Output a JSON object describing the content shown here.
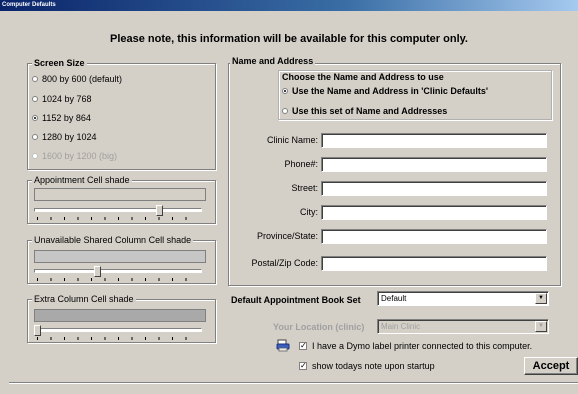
{
  "window": {
    "title": "Computer Defaults"
  },
  "notice": "Please note, this information will be available for this computer only.",
  "screen_size": {
    "title": "Screen Size",
    "options": [
      {
        "label": "800 by 600 (default)",
        "checked": false,
        "disabled": false
      },
      {
        "label": "1024 by 768",
        "checked": false,
        "disabled": false
      },
      {
        "label": "1152 by 864",
        "checked": true,
        "disabled": false
      },
      {
        "label": "1280 by 1024",
        "checked": false,
        "disabled": false
      },
      {
        "label": "1600 by 1200 (big)",
        "checked": false,
        "disabled": true
      }
    ]
  },
  "shades": {
    "appointment": {
      "title": "Appointment Cell shade",
      "color": "#d4d0c8",
      "level": 0.78
    },
    "unavailable": {
      "title": "Unavailable Shared Column Cell shade",
      "color": "#c6c6c6",
      "level": 0.36
    },
    "extra": {
      "title": "Extra Column Cell shade",
      "color": "#a9a9a9",
      "level": 0.0
    }
  },
  "name_address": {
    "title": "Name and Address",
    "choose_heading": "Choose the Name and Address to use",
    "options": [
      {
        "label": "Use the Name and Address in 'Clinic Defaults'",
        "checked": true
      },
      {
        "label": "Use this set of Name and Addresses",
        "checked": false
      }
    ],
    "fields": [
      {
        "label": "Clinic Name:",
        "value": ""
      },
      {
        "label": "Phone#:",
        "value": ""
      },
      {
        "label": "Street:",
        "value": ""
      },
      {
        "label": "City:",
        "value": ""
      },
      {
        "label": "Province/State:",
        "value": ""
      },
      {
        "label": "Postal/Zip Code:",
        "value": ""
      }
    ]
  },
  "book_set": {
    "label": "Default Appointment Book Set",
    "value": "Default"
  },
  "location": {
    "label": "Your Location (clinic)",
    "value": "Main Clinic"
  },
  "dymo": {
    "label": "I have a Dymo label printer connected to this computer.",
    "checked": true,
    "icon": "printer-icon"
  },
  "todays_note": {
    "label": "show todays note upon startup",
    "checked": true
  },
  "accept_label": "Accept"
}
